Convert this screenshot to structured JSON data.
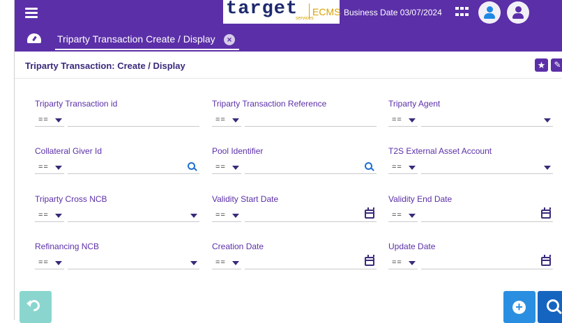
{
  "header": {
    "logo_text": "target",
    "logo_sub": "services",
    "logo_product": "ECMS",
    "business_date": "Business Date 03/07/2024"
  },
  "tabs": [
    {
      "label": "Triparty Transaction Create / Display",
      "close": "×"
    }
  ],
  "page": {
    "title": "Triparty Transaction: Create / Display",
    "star": "★",
    "edit": "✎"
  },
  "fields": [
    {
      "label": "Triparty Transaction id",
      "operator": "==",
      "value": "",
      "type": "text"
    },
    {
      "label": "Triparty Transaction Reference",
      "operator": "==",
      "value": "",
      "type": "text"
    },
    {
      "label": "Triparty Agent",
      "operator": "==",
      "value": "",
      "type": "select"
    },
    {
      "label": "Collateral Giver Id",
      "operator": "==",
      "value": "",
      "type": "lookup"
    },
    {
      "label": "Pool Identifier",
      "operator": "==",
      "value": "",
      "type": "lookup"
    },
    {
      "label": "T2S External Asset Account",
      "operator": "==",
      "value": "",
      "type": "select"
    },
    {
      "label": "Triparty Cross NCB",
      "operator": "==",
      "value": "",
      "type": "select"
    },
    {
      "label": "Validity Start Date",
      "operator": "==",
      "value": "",
      "type": "date"
    },
    {
      "label": "Validity End Date",
      "operator": "==",
      "value": "",
      "type": "date"
    },
    {
      "label": "Refinancing NCB",
      "operator": "==",
      "value": "",
      "type": "select"
    },
    {
      "label": "Creation Date",
      "operator": "==",
      "value": "",
      "type": "date"
    },
    {
      "label": "Update Date",
      "operator": "==",
      "value": "",
      "type": "date"
    }
  ],
  "icons": {
    "menu": "hamburger-icon",
    "apps": "grid-icon",
    "dashboard": "dashboard-icon",
    "reset": "reset-icon",
    "add": "add-icon",
    "search": "search-icon"
  },
  "colors": {
    "brand": "#5b2fa8",
    "accent": "#2a8fe0",
    "reset": "#8ad6cf"
  }
}
